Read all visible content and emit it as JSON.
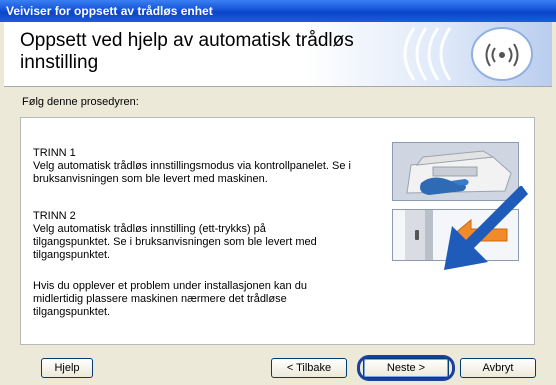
{
  "window": {
    "title": "Veiviser for oppsett av trådløs enhet"
  },
  "header": {
    "title": "Oppsett ved hjelp av automatisk trådløs innstilling",
    "wireless_icon": "wireless-icon"
  },
  "content": {
    "instruction": "Følg denne prosedyren:",
    "steps": [
      {
        "title": "TRINN 1",
        "text": "Velg automatisk trådløs innstillingsmodus via kontrollpanelet. Se i bruksanvisningen som ble levert med maskinen.",
        "image": "printer-control-panel-icon"
      },
      {
        "title": "TRINN 2",
        "text": "Velg automatisk trådløs innstilling (ett-trykks) på tilgangspunktet. Se i bruksanvisningen som ble levert med tilgangspunktet.",
        "image": "access-point-button-icon"
      }
    ],
    "note": "Hvis du opplever et problem under installasjonen kan du midlertidig plassere maskinen nærmere det trådløse tilgangspunktet."
  },
  "buttons": {
    "help": "Hjelp",
    "back": "< Tilbake",
    "next": "Neste >",
    "cancel": "Avbryt"
  },
  "colors": {
    "titlebar": "#0b45c8",
    "annotation_arrow": "#1f5bb8"
  }
}
